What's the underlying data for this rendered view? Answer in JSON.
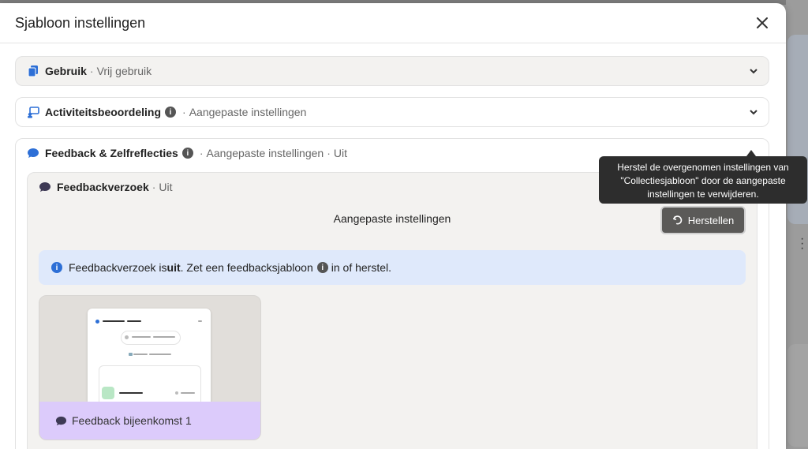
{
  "modal": {
    "title": "Sjabloon instellingen"
  },
  "sections": {
    "gebruik": {
      "title": "Gebruik",
      "sep": "·",
      "subtitle": "Vrij gebruik"
    },
    "activiteit": {
      "title": "Activiteitsbeoordeling",
      "sep": "·",
      "subtitle": "Aangepaste instellingen"
    },
    "feedback": {
      "title": "Feedback & Zelfreflecties",
      "sep": "·",
      "subtitle": "Aangepaste instellingen",
      "sep2": "·",
      "status": "Uit"
    }
  },
  "feedbackverzoek": {
    "title": "Feedbackverzoek",
    "sep": "·",
    "status": "Uit",
    "settings_label": "Aangepaste instellingen",
    "restore_button": "Herstellen",
    "alert": {
      "part1": "Feedbackverzoek is ",
      "bold": "uit",
      "part2": ". Zet een feedbacksjabloon",
      "part3": " in of herstel."
    },
    "template_card_label": "Feedback bijeenkomst 1"
  },
  "tooltip": {
    "text": "Herstel de overgenomen instellingen van \"Collectiesjabloon\" door de aangepaste instellingen te verwijderen."
  },
  "colors": {
    "accent_blue": "#2d6fd6",
    "restore_bg": "#5b5a58",
    "card_footer": "#dccbfb",
    "alert_bg": "#dfe9fb"
  }
}
